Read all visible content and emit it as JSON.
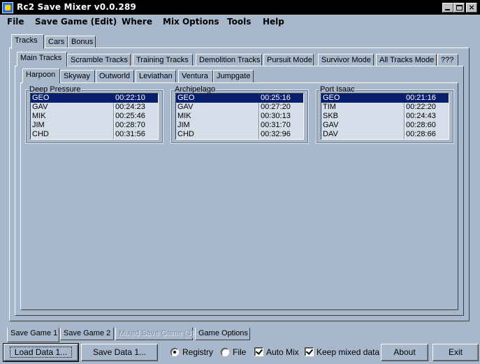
{
  "window": {
    "title": "Rc2 Save Mixer v0.0.289",
    "controls": {
      "minimize": "_",
      "maximize": "□",
      "close": "×"
    }
  },
  "menu": [
    "File",
    "Save Game (Edit)",
    "Where",
    "Mix Options",
    "Tools",
    "Help"
  ],
  "tabs_top": [
    "Tracks",
    "Cars",
    "Bonus"
  ],
  "tabs_mode": [
    "Main Tracks",
    "Scramble Tracks",
    "Training Tracks",
    "Demolition Tracks",
    "Pursuit Mode",
    "Survivor Mode",
    "All Tracks Mode",
    "???"
  ],
  "tabs_world": [
    "Harpoon",
    "Skyway",
    "Outworld",
    "Leviathan",
    "Ventura",
    "Jumpgate"
  ],
  "track_groups": [
    {
      "title": "Deep Pressure",
      "rows": [
        {
          "name": "GEO",
          "time": "00:22:10"
        },
        {
          "name": "GAV",
          "time": "00:24:23"
        },
        {
          "name": "MIK",
          "time": "00:25:46"
        },
        {
          "name": "JIM",
          "time": "00:28:70"
        },
        {
          "name": "CHD",
          "time": "00:31:56"
        }
      ]
    },
    {
      "title": "Archipelago",
      "rows": [
        {
          "name": "GEO",
          "time": "00:25:16"
        },
        {
          "name": "GAV",
          "time": "00:27:20"
        },
        {
          "name": "MIK",
          "time": "00:30:13"
        },
        {
          "name": "JIM",
          "time": "00:31:70"
        },
        {
          "name": "CHD",
          "time": "00:32:96"
        }
      ]
    },
    {
      "title": "Port Isaac",
      "rows": [
        {
          "name": "GEO",
          "time": "00:21:16"
        },
        {
          "name": "TIM",
          "time": "00:22:20"
        },
        {
          "name": "SKB",
          "time": "00:24:43"
        },
        {
          "name": "GAV",
          "time": "00:28:60"
        },
        {
          "name": "DAV",
          "time": "00:28:66"
        }
      ]
    }
  ],
  "tabs_bottom": [
    "Save Game 1",
    "Save Game 2",
    "Mixed Save Game (3)",
    "Game Options"
  ],
  "buttons": {
    "load": "Load Data 1...",
    "save": "Save Data 1...",
    "about": "About",
    "exit": "Exit"
  },
  "options": {
    "registry": "Registry",
    "file": "File",
    "auto_mix": "Auto Mix",
    "keep_mixed": "Keep mixed data"
  },
  "colors": {
    "background": "#a8b8cc",
    "selection": "#0a1e6e",
    "list_bg": "#d4dde8"
  }
}
